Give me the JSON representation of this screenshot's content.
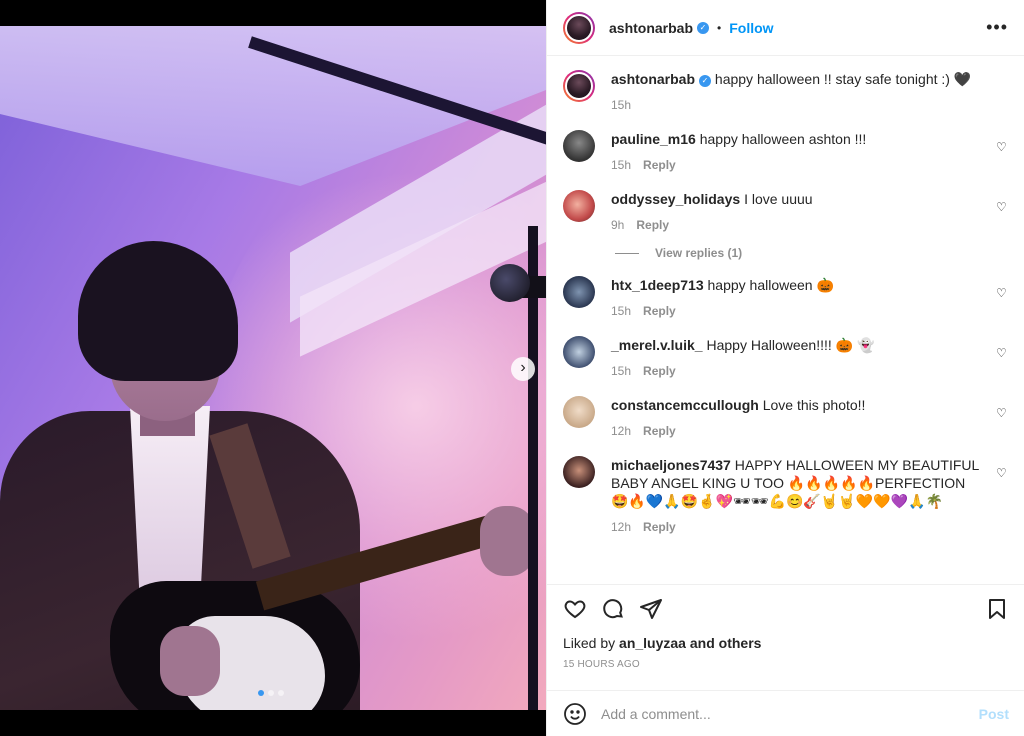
{
  "post": {
    "username": "ashtonarbab",
    "follow_label": "Follow",
    "separator": "•",
    "more_label": "•••",
    "caption": "happy halloween !! stay safe tonight :) 🖤",
    "caption_time": "15h"
  },
  "carousel": {
    "next_label": "›",
    "slides": 3,
    "active_index": 0
  },
  "comments": [
    {
      "user": "pauline_m16",
      "text": "happy halloween ashton !!!",
      "time": "15h",
      "reply": "Reply"
    },
    {
      "user": "oddyssey_holidays",
      "text": "I love uuuu",
      "time": "9h",
      "reply": "Reply",
      "view_replies": "View replies (1)"
    },
    {
      "user": "htx_1deep713",
      "text": "happy halloween 🎃",
      "time": "15h",
      "reply": "Reply"
    },
    {
      "user": "_merel.v.luik_",
      "text": "Happy Halloween!!!! 🎃 👻",
      "time": "15h",
      "reply": "Reply"
    },
    {
      "user": "constancemccullough",
      "text": "Love this photo!!",
      "time": "12h",
      "reply": "Reply"
    },
    {
      "user": "michaeljones7437",
      "text": "HAPPY HALLOWEEN MY BEAUTIFUL BABY ANGEL KING U TOO 🔥🔥🔥🔥🔥PERFECTION 🤩🔥💙🙏🤩🤞💖🕶🕶💪😊🎸🤘🤘🧡🧡💜🙏🌴",
      "time": "12h",
      "reply": "Reply"
    }
  ],
  "footer": {
    "liked_prefix": "Liked by",
    "liked_user": "an_luyzaa",
    "liked_suffix": "and others",
    "time_ago": "15 HOURS AGO",
    "comment_placeholder": "Add a comment...",
    "post_label": "Post"
  },
  "colors": {
    "accent": "#0095f6",
    "verified": "#3897f0",
    "muted": "#8e8e8e",
    "text": "#262626"
  }
}
